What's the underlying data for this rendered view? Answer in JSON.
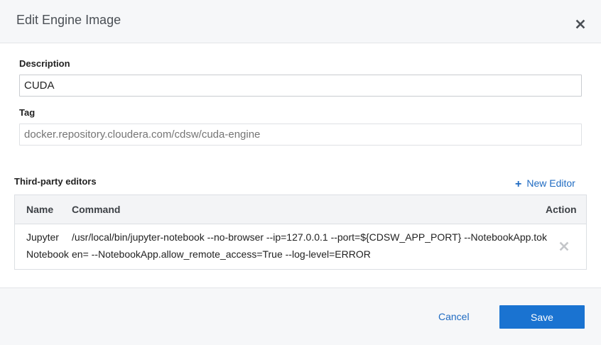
{
  "dialog": {
    "title": "Edit Engine Image",
    "close_icon": "close-icon"
  },
  "description": {
    "label": "Description",
    "value": "CUDA"
  },
  "tag": {
    "label": "Tag",
    "placeholder": "docker.repository.cloudera.com/cdsw/cuda-engine"
  },
  "editors": {
    "title": "Third-party editors",
    "new_label": "New Editor",
    "new_icon": "plus-icon",
    "columns": {
      "name": "Name",
      "command": "Command",
      "action": "Action"
    },
    "rows": [
      {
        "name_line1": "Jupyter",
        "name_line2": "Notebook",
        "command_line1": "/usr/local/bin/jupyter-notebook --no-browser --ip=127.0.0.1 --port=${CDSW_APP_PORT} --NotebookApp.tok",
        "command_line2": "en= --NotebookApp.allow_remote_access=True --log-level=ERROR",
        "remove_icon": "remove-icon"
      }
    ]
  },
  "footer": {
    "cancel_label": "Cancel",
    "save_label": "Save"
  },
  "colors": {
    "accent": "#1a73d1",
    "link": "#1f6bc2",
    "header_bg": "#f6f7f9"
  }
}
